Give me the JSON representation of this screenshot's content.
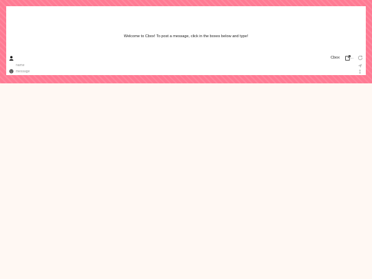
{
  "chat": {
    "welcome_text": "Welcome to Cbox! To post a message, click in the boxes below and type!",
    "brand_link": "Cbox",
    "more_menu": "...",
    "name_placeholder": "name",
    "message_placeholder": "message"
  },
  "colors": {
    "header_background": "#ff7a93",
    "page_background": "#fff8f3",
    "panel_background": "#ffffff"
  },
  "icons": {
    "user": "user-icon",
    "popout": "external-link-icon",
    "refresh": "refresh-icon",
    "send": "send-icon",
    "emoji": "emoji-icon",
    "resize": "resize-icon"
  }
}
